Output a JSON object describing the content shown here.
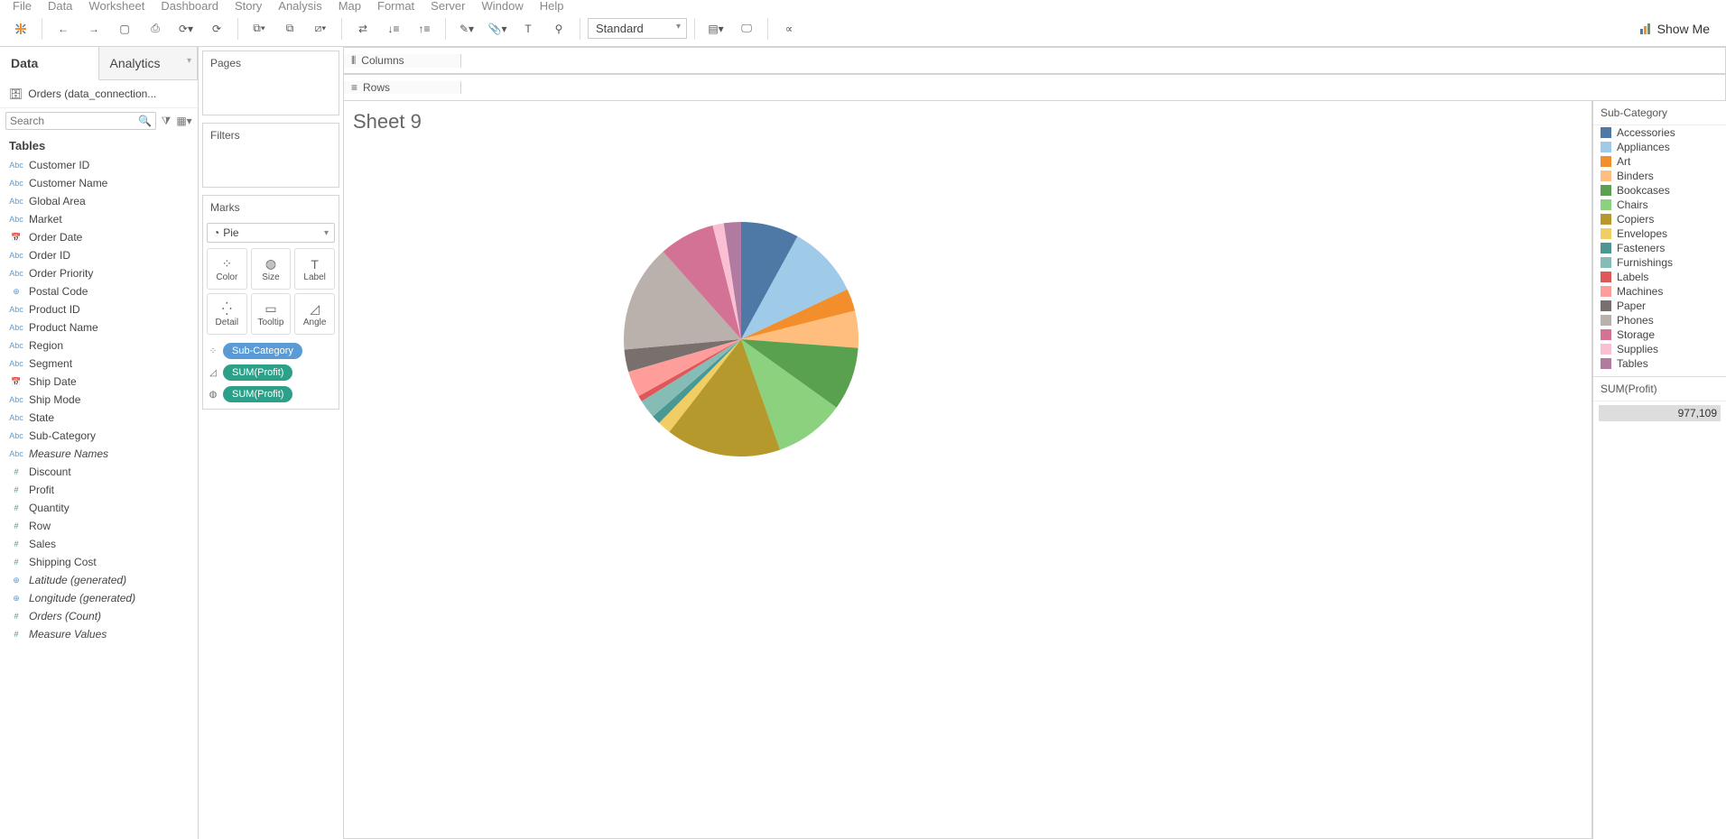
{
  "menu": [
    "File",
    "Data",
    "Worksheet",
    "Dashboard",
    "Story",
    "Analysis",
    "Map",
    "Format",
    "Server",
    "Window",
    "Help"
  ],
  "toolbar": {
    "fit": "Standard",
    "showme": "Show Me"
  },
  "side_tabs": {
    "data": "Data",
    "analytics": "Analytics"
  },
  "datasource": "Orders (data_connection...",
  "search_placeholder": "Search",
  "tables_header": "Tables",
  "fields": [
    {
      "icon": "abc",
      "label": "Customer ID"
    },
    {
      "icon": "abc",
      "label": "Customer Name"
    },
    {
      "icon": "abc",
      "label": "Global Area"
    },
    {
      "icon": "abc",
      "label": "Market"
    },
    {
      "icon": "date",
      "label": "Order Date"
    },
    {
      "icon": "abc",
      "label": "Order ID"
    },
    {
      "icon": "abc",
      "label": "Order Priority"
    },
    {
      "icon": "globe",
      "label": "Postal Code"
    },
    {
      "icon": "abc",
      "label": "Product ID"
    },
    {
      "icon": "abc",
      "label": "Product Name"
    },
    {
      "icon": "abc",
      "label": "Region"
    },
    {
      "icon": "abc",
      "label": "Segment"
    },
    {
      "icon": "date",
      "label": "Ship Date"
    },
    {
      "icon": "abc",
      "label": "Ship Mode"
    },
    {
      "icon": "abc",
      "label": "State"
    },
    {
      "icon": "abc",
      "label": "Sub-Category"
    },
    {
      "icon": "abc",
      "label": "Measure Names",
      "italic": true
    },
    {
      "icon": "hash",
      "label": "Discount"
    },
    {
      "icon": "hash",
      "label": "Profit"
    },
    {
      "icon": "hash",
      "label": "Quantity"
    },
    {
      "icon": "hash",
      "label": "Row"
    },
    {
      "icon": "hash",
      "label": "Sales"
    },
    {
      "icon": "hash",
      "label": "Shipping Cost"
    },
    {
      "icon": "globe",
      "label": "Latitude (generated)",
      "italic": true
    },
    {
      "icon": "globe",
      "label": "Longitude (generated)",
      "italic": true
    },
    {
      "icon": "hash",
      "label": "Orders (Count)",
      "italic": true
    },
    {
      "icon": "hash",
      "label": "Measure Values",
      "italic": true
    }
  ],
  "cards": {
    "pages": "Pages",
    "filters": "Filters",
    "marks": "Marks"
  },
  "mark_type": "Pie",
  "mark_cells": {
    "color": "Color",
    "size": "Size",
    "label": "Label",
    "detail": "Detail",
    "tooltip": "Tooltip",
    "angle": "Angle"
  },
  "pills": [
    {
      "icon": "color",
      "label": "Sub-Category",
      "cls": "pill-blue"
    },
    {
      "icon": "angle",
      "label": "SUM(Profit)",
      "cls": "pill-green"
    },
    {
      "icon": "size",
      "label": "SUM(Profit)",
      "cls": "pill-green"
    }
  ],
  "shelves": {
    "columns": "Columns",
    "rows": "Rows"
  },
  "sheet_title": "Sheet 9",
  "legend_title": "Sub-Category",
  "legend": [
    {
      "label": "Accessories",
      "color": "#4e79a7"
    },
    {
      "label": "Appliances",
      "color": "#a0cbe8"
    },
    {
      "label": "Art",
      "color": "#f28e2b"
    },
    {
      "label": "Binders",
      "color": "#ffbe7d"
    },
    {
      "label": "Bookcases",
      "color": "#59a14f"
    },
    {
      "label": "Chairs",
      "color": "#8cd17d"
    },
    {
      "label": "Copiers",
      "color": "#b6992d"
    },
    {
      "label": "Envelopes",
      "color": "#f1ce63"
    },
    {
      "label": "Fasteners",
      "color": "#499894"
    },
    {
      "label": "Furnishings",
      "color": "#86bcb6"
    },
    {
      "label": "Labels",
      "color": "#e15759"
    },
    {
      "label": "Machines",
      "color": "#ff9d9a"
    },
    {
      "label": "Paper",
      "color": "#79706e"
    },
    {
      "label": "Phones",
      "color": "#bab0ac"
    },
    {
      "label": "Storage",
      "color": "#d37295"
    },
    {
      "label": "Supplies",
      "color": "#fabfd2"
    },
    {
      "label": "Tables",
      "color": "#b07aa1"
    }
  ],
  "sum_card": {
    "title": "SUM(Profit)",
    "value": "977,109"
  },
  "chart_data": {
    "type": "pie",
    "title": "Sheet 9",
    "series_name": "SUM(Profit)",
    "total": 977109,
    "slices": [
      {
        "category": "Accessories",
        "value": 78000,
        "color": "#4e79a7"
      },
      {
        "category": "Appliances",
        "value": 98000,
        "color": "#a0cbe8"
      },
      {
        "category": "Art",
        "value": 30000,
        "color": "#f28e2b"
      },
      {
        "category": "Binders",
        "value": 50000,
        "color": "#ffbe7d"
      },
      {
        "category": "Bookcases",
        "value": 85000,
        "color": "#59a14f"
      },
      {
        "category": "Chairs",
        "value": 95000,
        "color": "#8cd17d"
      },
      {
        "category": "Copiers",
        "value": 155000,
        "color": "#b6992d"
      },
      {
        "category": "Envelopes",
        "value": 18000,
        "color": "#f1ce63"
      },
      {
        "category": "Fasteners",
        "value": 12000,
        "color": "#499894"
      },
      {
        "category": "Furnishings",
        "value": 25000,
        "color": "#86bcb6"
      },
      {
        "category": "Labels",
        "value": 8000,
        "color": "#e15759"
      },
      {
        "category": "Machines",
        "value": 35000,
        "color": "#ff9d9a"
      },
      {
        "category": "Paper",
        "value": 30000,
        "color": "#79706e"
      },
      {
        "category": "Phones",
        "value": 145000,
        "color": "#bab0ac"
      },
      {
        "category": "Storage",
        "value": 75000,
        "color": "#d37295"
      },
      {
        "category": "Supplies",
        "value": 15000,
        "color": "#fabfd2"
      },
      {
        "category": "Tables",
        "value": 23109,
        "color": "#b07aa1"
      }
    ]
  }
}
